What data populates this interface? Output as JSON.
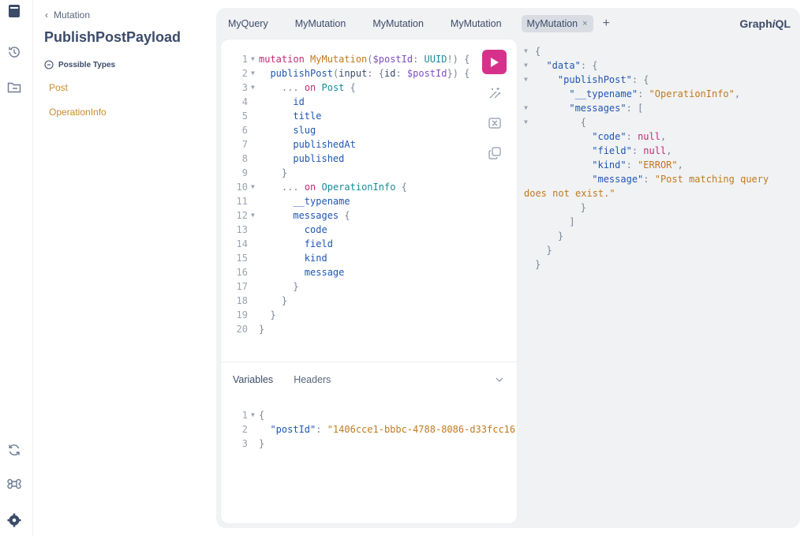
{
  "docs": {
    "back_label": "Mutation",
    "title": "PublishPostPayload",
    "section_label": "Possible Types",
    "types": [
      "Post",
      "OperationInfo"
    ]
  },
  "tabs": [
    {
      "label": "MyQuery"
    },
    {
      "label": "MyMutation"
    },
    {
      "label": "MyMutation"
    },
    {
      "label": "MyMutation"
    },
    {
      "label": "MyMutation",
      "active": true
    }
  ],
  "tab_close": "×",
  "tab_add": "+",
  "brand": {
    "pre": "Graph",
    "italic": "i",
    "post": "QL"
  },
  "query_lines": [
    {
      "n": "1",
      "fold": true,
      "segs": [
        [
          "kw",
          "mutation "
        ],
        [
          "def",
          "MyMutation"
        ],
        [
          "pun",
          "("
        ],
        [
          "var",
          "$postId"
        ],
        [
          "pun",
          ": "
        ],
        [
          "typ",
          "UUID"
        ],
        [
          "pun",
          "!) {"
        ]
      ]
    },
    {
      "n": "2",
      "fold": true,
      "segs": [
        [
          "ct",
          "  "
        ],
        [
          "fld",
          "publishPost"
        ],
        [
          "pun",
          "("
        ],
        [
          "ct",
          "input"
        ],
        [
          "pun",
          ": {"
        ],
        [
          "ct",
          "id"
        ],
        [
          "pun",
          ": "
        ],
        [
          "var",
          "$postId"
        ],
        [
          "pun",
          "}) {"
        ]
      ]
    },
    {
      "n": "3",
      "fold": true,
      "segs": [
        [
          "ct",
          "    "
        ],
        [
          "pun",
          "... "
        ],
        [
          "kw",
          "on "
        ],
        [
          "typ",
          "Post"
        ],
        [
          "pun",
          " {"
        ]
      ]
    },
    {
      "n": "4",
      "fold": false,
      "segs": [
        [
          "ct",
          "      "
        ],
        [
          "fld",
          "id"
        ]
      ]
    },
    {
      "n": "5",
      "fold": false,
      "segs": [
        [
          "ct",
          "      "
        ],
        [
          "fld",
          "title"
        ]
      ]
    },
    {
      "n": "6",
      "fold": false,
      "segs": [
        [
          "ct",
          "      "
        ],
        [
          "fld",
          "slug"
        ]
      ]
    },
    {
      "n": "7",
      "fold": false,
      "segs": [
        [
          "ct",
          "      "
        ],
        [
          "fld",
          "publishedAt"
        ]
      ]
    },
    {
      "n": "8",
      "fold": false,
      "segs": [
        [
          "ct",
          "      "
        ],
        [
          "fld",
          "published"
        ]
      ]
    },
    {
      "n": "9",
      "fold": false,
      "segs": [
        [
          "ct",
          "    "
        ],
        [
          "pun",
          "}"
        ]
      ]
    },
    {
      "n": "10",
      "fold": true,
      "segs": [
        [
          "ct",
          "    "
        ],
        [
          "pun",
          "... "
        ],
        [
          "kw",
          "on "
        ],
        [
          "typ",
          "OperationInfo"
        ],
        [
          "pun",
          " {"
        ]
      ]
    },
    {
      "n": "11",
      "fold": false,
      "segs": [
        [
          "ct",
          "      "
        ],
        [
          "fld",
          "__typename"
        ]
      ]
    },
    {
      "n": "12",
      "fold": true,
      "segs": [
        [
          "ct",
          "      "
        ],
        [
          "fld",
          "messages"
        ],
        [
          "pun",
          " {"
        ]
      ]
    },
    {
      "n": "13",
      "fold": false,
      "segs": [
        [
          "ct",
          "        "
        ],
        [
          "fld",
          "code"
        ]
      ]
    },
    {
      "n": "14",
      "fold": false,
      "segs": [
        [
          "ct",
          "        "
        ],
        [
          "fld",
          "field"
        ]
      ]
    },
    {
      "n": "15",
      "fold": false,
      "segs": [
        [
          "ct",
          "        "
        ],
        [
          "fld",
          "kind"
        ]
      ]
    },
    {
      "n": "16",
      "fold": false,
      "segs": [
        [
          "ct",
          "        "
        ],
        [
          "fld",
          "message"
        ]
      ]
    },
    {
      "n": "17",
      "fold": false,
      "segs": [
        [
          "ct",
          "      "
        ],
        [
          "pun",
          "}"
        ]
      ]
    },
    {
      "n": "18",
      "fold": false,
      "segs": [
        [
          "ct",
          "    "
        ],
        [
          "pun",
          "}"
        ]
      ]
    },
    {
      "n": "19",
      "fold": false,
      "segs": [
        [
          "ct",
          "  "
        ],
        [
          "pun",
          "}"
        ]
      ]
    },
    {
      "n": "20",
      "fold": false,
      "segs": [
        [
          "pun",
          "}"
        ]
      ]
    }
  ],
  "variables_tab": "Variables",
  "headers_tab": "Headers",
  "variables_lines": [
    {
      "n": "1",
      "fold": true,
      "segs": [
        [
          "pun",
          "{"
        ]
      ]
    },
    {
      "n": "2",
      "fold": false,
      "segs": [
        [
          "ct",
          "  "
        ],
        [
          "prop",
          "\"postId\""
        ],
        [
          "pun",
          ": "
        ],
        [
          "str",
          "\"1406cce1-bbbc-4788-8086-d33fcc16"
        ]
      ]
    },
    {
      "n": "3",
      "fold": false,
      "segs": [
        [
          "pun",
          "}"
        ]
      ]
    }
  ],
  "response_lines": [
    {
      "fold": true,
      "segs": [
        [
          "pun",
          "{"
        ]
      ]
    },
    {
      "fold": true,
      "segs": [
        [
          "ct",
          "  "
        ],
        [
          "prop",
          "\"data\""
        ],
        [
          "pun",
          ": {"
        ]
      ]
    },
    {
      "fold": true,
      "segs": [
        [
          "ct",
          "    "
        ],
        [
          "prop",
          "\"publishPost\""
        ],
        [
          "pun",
          ": {"
        ]
      ]
    },
    {
      "fold": false,
      "segs": [
        [
          "ct",
          "      "
        ],
        [
          "prop",
          "\"__typename\""
        ],
        [
          "pun",
          ": "
        ],
        [
          "str",
          "\"OperationInfo\""
        ],
        [
          "pun",
          ","
        ]
      ]
    },
    {
      "fold": true,
      "segs": [
        [
          "ct",
          "      "
        ],
        [
          "prop",
          "\"messages\""
        ],
        [
          "pun",
          ": ["
        ]
      ]
    },
    {
      "fold": true,
      "segs": [
        [
          "ct",
          "        "
        ],
        [
          "pun",
          "{"
        ]
      ]
    },
    {
      "fold": false,
      "segs": [
        [
          "ct",
          "          "
        ],
        [
          "prop",
          "\"code\""
        ],
        [
          "pun",
          ": "
        ],
        [
          "null",
          "null"
        ],
        [
          "pun",
          ","
        ]
      ]
    },
    {
      "fold": false,
      "segs": [
        [
          "ct",
          "          "
        ],
        [
          "prop",
          "\"field\""
        ],
        [
          "pun",
          ": "
        ],
        [
          "null",
          "null"
        ],
        [
          "pun",
          ","
        ]
      ]
    },
    {
      "fold": false,
      "segs": [
        [
          "ct",
          "          "
        ],
        [
          "prop",
          "\"kind\""
        ],
        [
          "pun",
          ": "
        ],
        [
          "str",
          "\"ERROR\""
        ],
        [
          "pun",
          ","
        ]
      ]
    },
    {
      "fold": false,
      "segs": [
        [
          "ct",
          "          "
        ],
        [
          "prop",
          "\"message\""
        ],
        [
          "pun",
          ": "
        ],
        [
          "str",
          "\"Post matching query"
        ]
      ]
    },
    {
      "fold": false,
      "nofold": true,
      "segs": [
        [
          "str",
          "does not exist.\""
        ]
      ]
    },
    {
      "fold": false,
      "segs": [
        [
          "ct",
          "        "
        ],
        [
          "pun",
          "}"
        ]
      ]
    },
    {
      "fold": false,
      "segs": [
        [
          "ct",
          "      "
        ],
        [
          "pun",
          "]"
        ]
      ]
    },
    {
      "fold": false,
      "segs": [
        [
          "ct",
          "    "
        ],
        [
          "pun",
          "}"
        ]
      ]
    },
    {
      "fold": false,
      "segs": [
        [
          "ct",
          "  "
        ],
        [
          "pun",
          "}"
        ]
      ]
    },
    {
      "fold": false,
      "segs": [
        [
          "pun",
          "}"
        ]
      ]
    }
  ],
  "icons": {
    "docs": "docs-icon",
    "history": "history-icon",
    "explorer": "explorer-icon",
    "refetch": "refetch-icon",
    "shortcuts": "command-icon",
    "settings": "settings-icon",
    "run": "play-icon",
    "prettify": "prettify-icon",
    "merge": "merge-icon",
    "copy": "copy-icon"
  }
}
